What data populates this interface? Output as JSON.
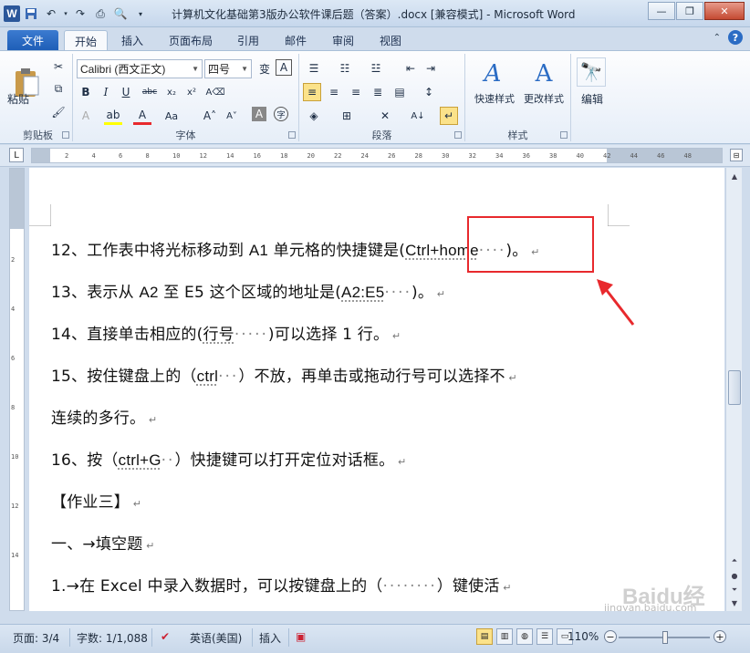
{
  "window": {
    "title": "计算机文化基础第3版办公软件课后题（答案）.docx [兼容模式] - Microsoft Word",
    "app_icon": "W"
  },
  "tabs": [
    "文件",
    "开始",
    "插入",
    "页面布局",
    "引用",
    "邮件",
    "审阅",
    "视图"
  ],
  "active_tab": "开始",
  "ribbon": {
    "clipboard": {
      "paste_label": "粘贴",
      "group_label": "剪贴板"
    },
    "font": {
      "font_name": "Calibri (西文正文)",
      "font_size": "四号",
      "group_label": "字体"
    },
    "paragraph": {
      "group_label": "段落"
    },
    "styles": {
      "quick_styles": "快速样式",
      "change_styles": "更改样式",
      "group_label": "样式"
    },
    "editing": {
      "label": "编辑"
    }
  },
  "ruler": {
    "ticks": [
      "2",
      "4",
      "6",
      "8",
      "10",
      "12",
      "14",
      "16",
      "18",
      "20",
      "22",
      "24",
      "26",
      "28",
      "30",
      "32",
      "34",
      "36",
      "38",
      "40",
      "42",
      "44",
      "46",
      "48"
    ]
  },
  "document": {
    "lines": [
      {
        "pre": "12、工作表中将光标移动到 ",
        "latin": "A1",
        "mid": " 单元格的快捷键是(",
        "answer": "Ctrl+home",
        "dots": "····",
        "post": ")。"
      },
      {
        "pre": "13、表示从 ",
        "latin": "A2",
        "mid": " 至 E5 这个区域的地址是(",
        "answer": "A2:E5",
        "dots": "····",
        "post": ")。"
      },
      {
        "pre": "14、直接单击相应的(",
        "latin": "",
        "mid": "",
        "answer": "行号",
        "dots": "·····",
        "post": ")可以选择 1 行。"
      },
      {
        "pre": "15、按住键盘上的（",
        "latin": "",
        "mid": "",
        "answer": "ctrl",
        "dots": "···",
        "post": "）不放，再单击或拖动行号可以选择不"
      },
      {
        "pre": "连续的多行。",
        "latin": "",
        "mid": "",
        "answer": "",
        "dots": "",
        "post": ""
      },
      {
        "pre": "16、按（",
        "latin": "",
        "mid": "",
        "answer": "ctrl+G",
        "dots": "··",
        "post": "）快捷键可以打开定位对话框。"
      },
      {
        "pre": "【作业三】",
        "latin": "",
        "mid": "",
        "answer": "",
        "dots": "",
        "post": ""
      },
      {
        "pre": "一、→填空题",
        "latin": "",
        "mid": "",
        "answer": "",
        "dots": "",
        "post": ""
      },
      {
        "pre": "1.→在 Excel 中录入数据时，可以按键盘上的（",
        "latin": "",
        "mid": "",
        "answer": "",
        "dots": "········",
        "post": "）键使活"
      }
    ],
    "watermark": "Baidu经验",
    "watermark_url": "jingyan.baidu.com"
  },
  "statusbar": {
    "page": "页面: 3/4",
    "words": "字数: 1/1,088",
    "language": "英语(美国)",
    "mode": "插入",
    "zoom": "110%"
  },
  "colors": {
    "highlight_box": "#e8292d",
    "arrow": "#e8292d",
    "ribbon_accent": "#2b579a"
  }
}
